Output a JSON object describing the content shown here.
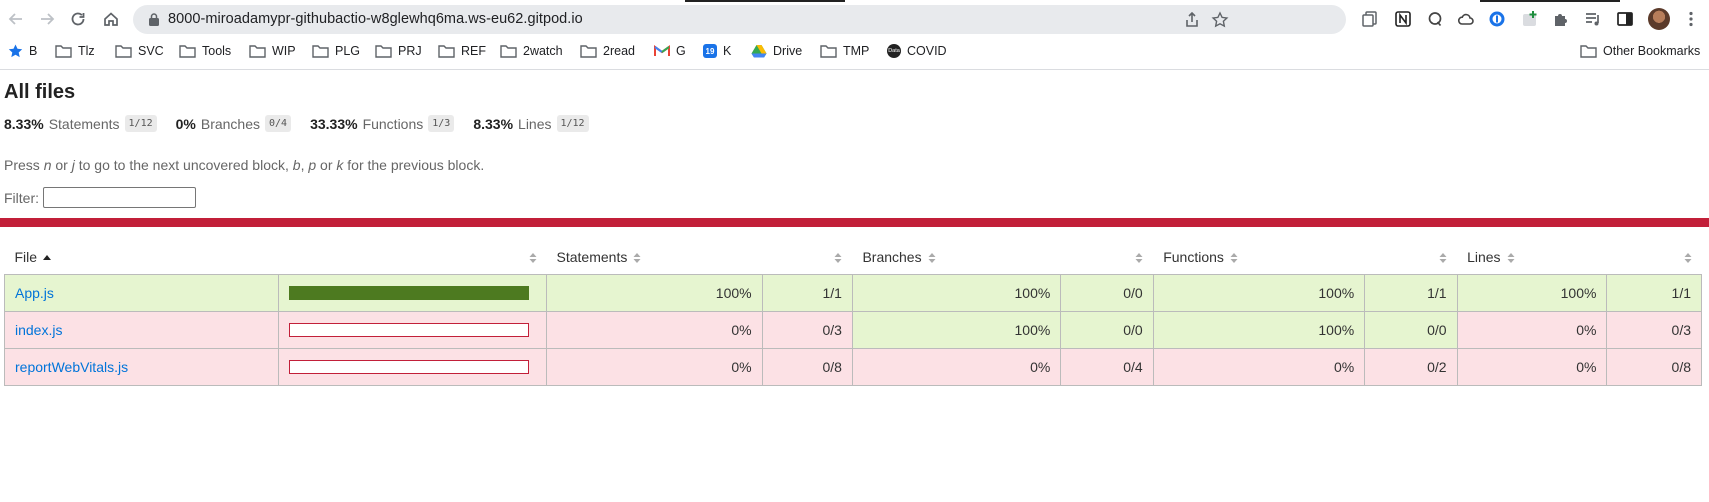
{
  "browser": {
    "url": "8000-miroadamypr-githubactio-w8glewhq6ma.ws-eu62.gitpod.io",
    "bookmarks": [
      {
        "label": "B",
        "icon": "star-icon"
      },
      {
        "label": "Tlz",
        "icon": "folder-icon"
      },
      {
        "label": "SVC",
        "icon": "folder-icon"
      },
      {
        "label": "Tools",
        "icon": "folder-icon"
      },
      {
        "label": "WIP",
        "icon": "folder-icon"
      },
      {
        "label": "PLG",
        "icon": "folder-icon"
      },
      {
        "label": "PRJ",
        "icon": "folder-icon"
      },
      {
        "label": "REF",
        "icon": "folder-icon"
      },
      {
        "label": "2watch",
        "icon": "folder-icon"
      },
      {
        "label": "2read",
        "icon": "folder-icon"
      },
      {
        "label": "G",
        "icon": "gmail-icon"
      },
      {
        "label": "K",
        "icon": "calendar-icon"
      },
      {
        "label": "Drive",
        "icon": "drive-icon"
      },
      {
        "label": "TMP",
        "icon": "folder-icon"
      },
      {
        "label": "COVID",
        "icon": "data-icon"
      }
    ],
    "other_bookmarks": "Other Bookmarks",
    "calendar_badge": "19",
    "data_badge": "Data"
  },
  "report": {
    "title": "All files",
    "summary": [
      {
        "pct": "8.33%",
        "label": "Statements",
        "frac": "1/12"
      },
      {
        "pct": "0%",
        "label": "Branches",
        "frac": "0/4"
      },
      {
        "pct": "33.33%",
        "label": "Functions",
        "frac": "1/3"
      },
      {
        "pct": "8.33%",
        "label": "Lines",
        "frac": "1/12"
      }
    ],
    "hint": {
      "p1": "Press ",
      "k1": "n",
      "p2": " or ",
      "k2": "j",
      "p3": " to go to the next uncovered block, ",
      "k3": "b",
      "p4": ", ",
      "k4": "p",
      "p5": " or ",
      "k5": "k",
      "p6": " for the previous block."
    },
    "filter_label": "Filter:",
    "filter_value": "",
    "columns": {
      "file": "File",
      "statements": "Statements",
      "branches": "Branches",
      "functions": "Functions",
      "lines": "Lines"
    },
    "rows": [
      {
        "file": "App.js",
        "coverage": 1.0,
        "stmt_pct": "100%",
        "stmt_frac": "1/1",
        "br_pct": "100%",
        "br_frac": "0/0",
        "fn_pct": "100%",
        "fn_frac": "1/1",
        "ln_pct": "100%",
        "ln_frac": "1/1"
      },
      {
        "file": "index.js",
        "coverage": 0.0,
        "stmt_pct": "0%",
        "stmt_frac": "0/3",
        "br_pct": "100%",
        "br_frac": "0/0",
        "fn_pct": "100%",
        "fn_frac": "0/0",
        "ln_pct": "0%",
        "ln_frac": "0/3"
      },
      {
        "file": "reportWebVitals.js",
        "coverage": 0.0,
        "stmt_pct": "0%",
        "stmt_frac": "0/8",
        "br_pct": "0%",
        "br_frac": "0/4",
        "fn_pct": "0%",
        "fn_frac": "0/2",
        "ln_pct": "0%",
        "ln_frac": "0/8"
      }
    ],
    "colors": {
      "high": "#e6f5d0",
      "low": "#fce1e5",
      "bar_fill": "#4d7a20",
      "accent_red": "#c21f39",
      "link": "#0074d9"
    }
  }
}
